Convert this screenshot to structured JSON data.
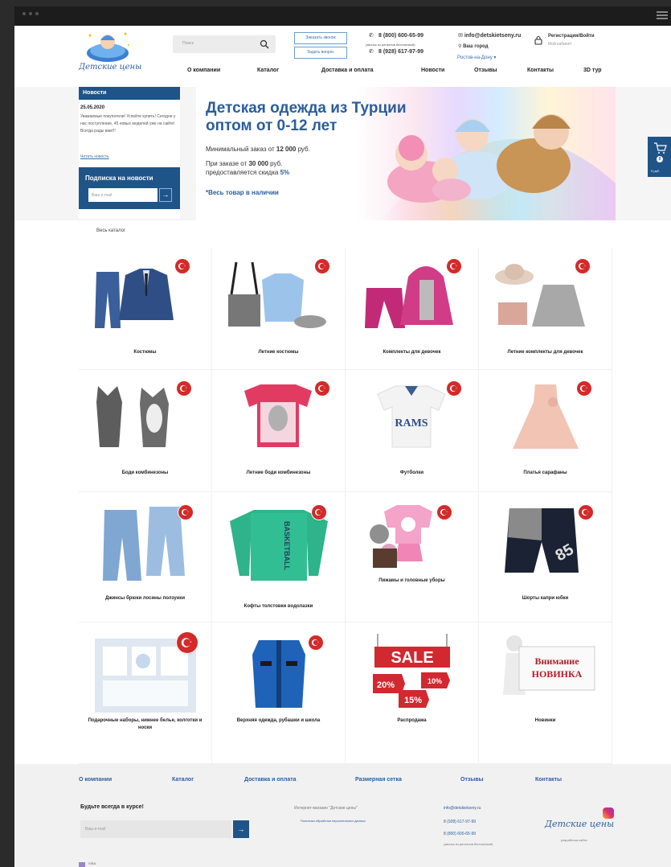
{
  "header": {
    "logo_text": "Детские цены",
    "search_placeholder": "Поиск",
    "btn_call": "Заказать звонок",
    "btn_question": "Задать вопрос",
    "phone1": "8 (800) 600-65-99",
    "phone1_note": "(звонок из регионов бесплатный)",
    "phone2": "8 (928) 617-97-99",
    "email": "info@detskietseny.ru",
    "city_label": "Ваш город",
    "city_value": "Ростов-на-Дону",
    "register": "Регистрация/Войти",
    "cabinet": "Мой кабинет"
  },
  "nav": [
    "О компании",
    "Каталог",
    "Доставка и оплата",
    "Новости",
    "Отзывы",
    "Контакты",
    "3D тур"
  ],
  "news": {
    "title": "Новости",
    "date": "25.05.2020",
    "text": "Уважаемые покупатели! Успейте купить! Сегодня у нас поступление, 45 новых моделей уже на сайте! Всегда рады вам!!!",
    "link": "Читать новость"
  },
  "subscribe": {
    "title": "Подписка на новости",
    "placeholder": "Ваш e-mail",
    "arrow": "→"
  },
  "banner": {
    "title": "Детская одежда из Турции оптом от 0-12 лет",
    "min_order_pre": "Минимальный заказ от ",
    "min_order_sum": "12 000",
    "min_order_post": " руб.",
    "discount_pre": "При заказе от ",
    "discount_sum": "30 000",
    "discount_mid": " руб. предоставляется скидка ",
    "discount_pct": "5%",
    "availability": "*Весь товар в наличии"
  },
  "cart": {
    "count": "0",
    "sum": "0 руб."
  },
  "all_catalog": "Весь каталог",
  "categories": [
    "Костюмы",
    "Летние костюмы",
    "Комплекты для девочек",
    "Летние комплекты для девочек",
    "Боди комбинезоны",
    "Летние боди комбинезоны",
    "Футболки",
    "Платья сарафаны",
    "Джинсы брюки лосины ползунки",
    "Кофты толстовки водолазки",
    "Пижамы и головные уборы",
    "Шорты капри юбки",
    "Подарочные наборы, нижнее белье, колготки и носки",
    "Верхняя одежда, рубашки и школа",
    "Распродажа",
    "Новинки"
  ],
  "product_art": {
    "tshirt_print": "RAMS",
    "sweater_print": "BASKETBALL",
    "shorts_number": "85",
    "sale_sign": "SALE",
    "sale_tag1": "20%",
    "sale_tag2": "10%",
    "sale_tag3": "15%",
    "new_sign_line1": "Внимание",
    "new_sign_line2": "НОВИНКА"
  },
  "footer": {
    "nav": [
      "О компании",
      "Каталог",
      "Доставка и оплата",
      "Размерная сетка",
      "Отзывы",
      "Контакты"
    ],
    "keep_title": "Будьте всегда в курсе!",
    "email_placeholder": "Ваш e-mail",
    "shop_name": "Интернет-магазин \"Детские цены\"",
    "policy": "Политика обработки персональных данных",
    "email": "info@detskietseny.ru",
    "phone1": "8 (928) 617-97-99",
    "phone2": "8 (800) 600-65-99",
    "phone2_note": "(звонок из регионов бесплатный)",
    "logo_text": "Детские цены",
    "developer": "разработка сайта",
    "checkbox_label": "VISA"
  },
  "colors": {
    "brand_blue": "#1f5488",
    "accent_blue": "#2a5d9c",
    "flag_red": "#d32a2a"
  }
}
